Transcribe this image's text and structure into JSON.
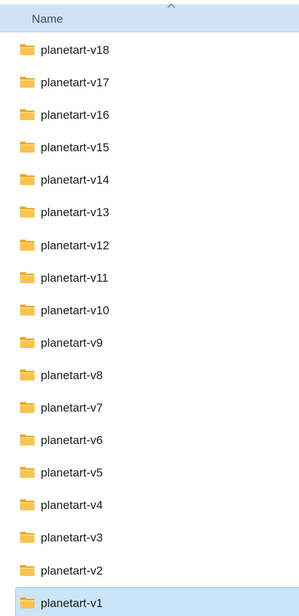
{
  "header": {
    "column_name": "Name",
    "sort_icon": "chevron-up-icon"
  },
  "colors": {
    "header_bg": "#cfe3f7",
    "selected_bg": "#cce4f7",
    "selected_border": "#99c9ef",
    "folder_fill": "#f8c44f",
    "folder_tab": "#e8a92a"
  },
  "folders": [
    {
      "label": "planetart-v18",
      "icon": "folder-icon",
      "selected": false
    },
    {
      "label": "planetart-v17",
      "icon": "folder-icon",
      "selected": false
    },
    {
      "label": "planetart-v16",
      "icon": "folder-icon",
      "selected": false
    },
    {
      "label": "planetart-v15",
      "icon": "folder-icon",
      "selected": false
    },
    {
      "label": "planetart-v14",
      "icon": "folder-icon",
      "selected": false
    },
    {
      "label": "planetart-v13",
      "icon": "folder-icon",
      "selected": false
    },
    {
      "label": "planetart-v12",
      "icon": "folder-icon",
      "selected": false
    },
    {
      "label": "planetart-v11",
      "icon": "folder-icon",
      "selected": false
    },
    {
      "label": "planetart-v10",
      "icon": "folder-icon",
      "selected": false
    },
    {
      "label": "planetart-v9",
      "icon": "folder-icon",
      "selected": false
    },
    {
      "label": "planetart-v8",
      "icon": "folder-icon",
      "selected": false
    },
    {
      "label": "planetart-v7",
      "icon": "folder-icon",
      "selected": false
    },
    {
      "label": "planetart-v6",
      "icon": "folder-icon",
      "selected": false
    },
    {
      "label": "planetart-v5",
      "icon": "folder-icon",
      "selected": false
    },
    {
      "label": "planetart-v4",
      "icon": "folder-icon",
      "selected": false
    },
    {
      "label": "planetart-v3",
      "icon": "folder-icon",
      "selected": false
    },
    {
      "label": "planetart-v2",
      "icon": "folder-icon",
      "selected": false
    },
    {
      "label": "planetart-v1",
      "icon": "folder-icon",
      "selected": true
    }
  ]
}
